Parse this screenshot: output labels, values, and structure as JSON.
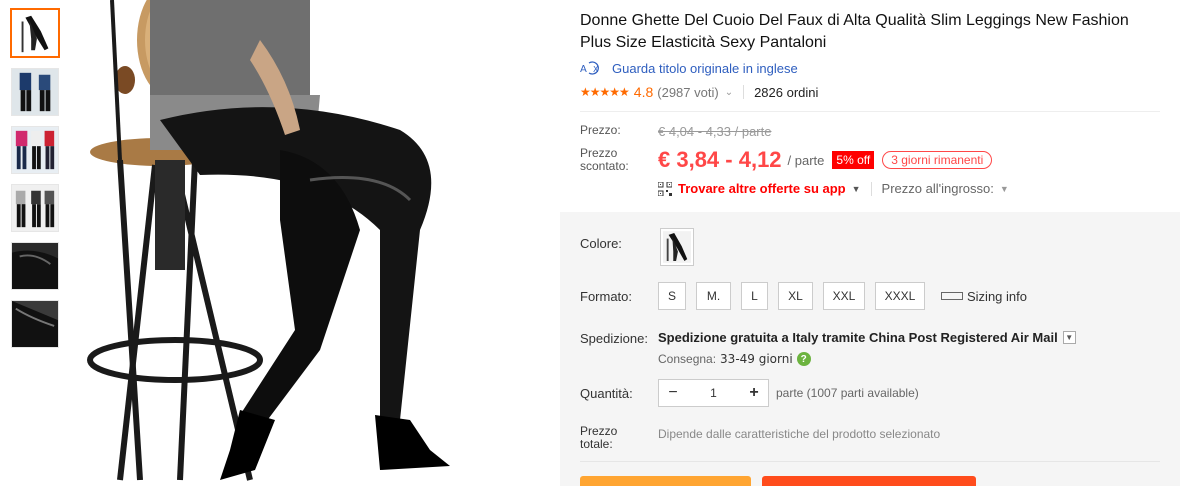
{
  "product": {
    "title": "Donne Ghette Del Cuoio Del Faux di Alta Qualità Slim Leggings New Fashion Plus Size Elasticità Sexy Pantaloni",
    "original_title_link": "Guarda titolo originale in inglese",
    "rating": {
      "stars": "★★★★★",
      "score": "4.8",
      "votes": "(2987 voti)",
      "orders": "2826 ordini"
    }
  },
  "price": {
    "label": "Prezzo:",
    "original": "€ 4,04 - 4,33 / parte",
    "discount_label": "Prezzo scontato:",
    "discounted": "€ 3,84 - 4,12",
    "unit": "/ parte",
    "off_badge": "5% off",
    "days_left": "3 giorni rimanenti",
    "app_offers": "Trovare altre offerte su app",
    "wholesale": "Prezzo all'ingrosso:"
  },
  "options": {
    "color_label": "Colore:",
    "size_label": "Formato:",
    "sizes": [
      "S",
      "M.",
      "L",
      "XL",
      "XXL",
      "XXXL"
    ],
    "size_info": "Sizing info",
    "shipping_label": "Spedizione:",
    "shipping_text": "Spedizione gratuita a Italy tramite China Post Registered Air Mail",
    "delivery_label": "Consegna:",
    "delivery_time": "33-49 giorni",
    "quantity_label": "Quantità:",
    "quantity": "1",
    "quantity_note": "parte (1007 parti available)",
    "total_label": "Prezzo totale:",
    "total_note": "Dipende dalle caratteristiche del prodotto selezionato"
  },
  "colors": {
    "accent": "#ff6a00",
    "price_red": "#ff4747",
    "link_blue": "#2e5ebf"
  }
}
